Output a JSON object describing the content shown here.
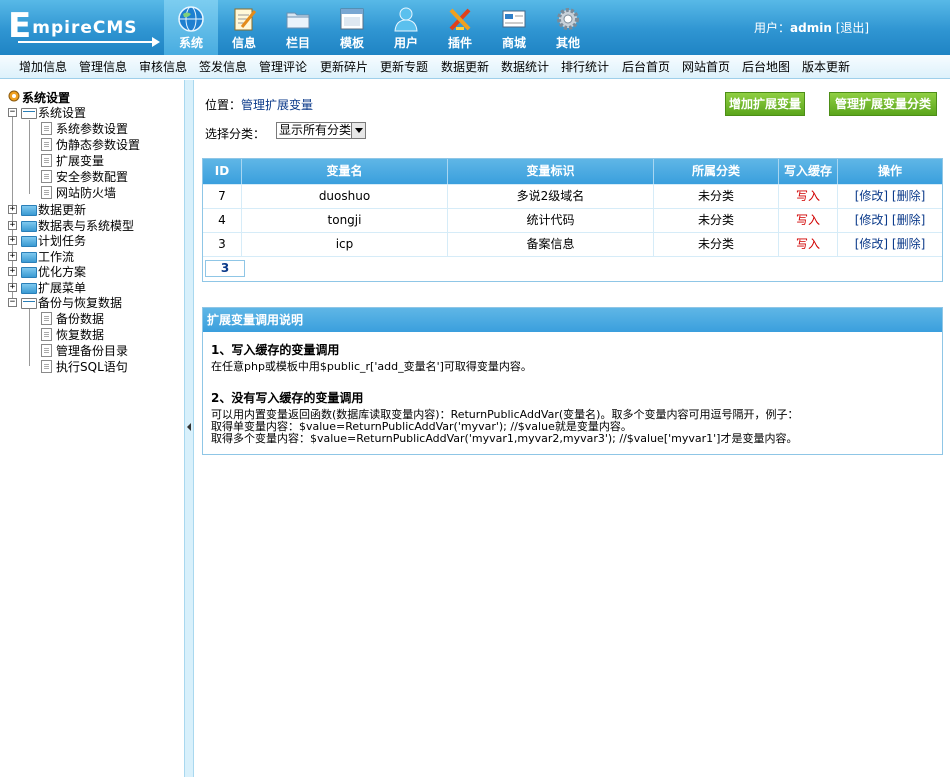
{
  "logo": {
    "big": "E",
    "rest": "mpireCMS"
  },
  "nav": [
    {
      "label": "系统",
      "icon": "globe-icon",
      "active": true
    },
    {
      "label": "信息",
      "icon": "notepad-icon"
    },
    {
      "label": "栏目",
      "icon": "folder-icon"
    },
    {
      "label": "模板",
      "icon": "window-icon"
    },
    {
      "label": "用户",
      "icon": "user-icon"
    },
    {
      "label": "插件",
      "icon": "tools-icon"
    },
    {
      "label": "商城",
      "icon": "card-icon"
    },
    {
      "label": "其他",
      "icon": "gear-icon"
    }
  ],
  "user": {
    "prefix": "用户：",
    "name": "admin",
    "logout": "[退出]"
  },
  "submenu": [
    "增加信息",
    "管理信息",
    "审核信息",
    "签发信息",
    "管理评论",
    "更新碎片",
    "更新专题",
    "数据更新",
    "数据统计",
    "排行统计",
    "后台首页",
    "网站首页",
    "后台地图",
    "版本更新"
  ],
  "sidebar": {
    "root": "系统设置",
    "groups": [
      {
        "label": "系统设置",
        "open": true,
        "children": [
          "系统参数设置",
          "伪静态参数设置",
          "扩展变量",
          "安全参数配置",
          "网站防火墙"
        ]
      },
      {
        "label": "数据更新"
      },
      {
        "label": "数据表与系统模型"
      },
      {
        "label": "计划任务"
      },
      {
        "label": "工作流"
      },
      {
        "label": "优化方案"
      },
      {
        "label": "扩展菜单"
      },
      {
        "label": "备份与恢复数据",
        "open": true,
        "children": [
          "备份数据",
          "恢复数据",
          "管理备份目录",
          "执行SQL语句"
        ]
      }
    ]
  },
  "location": {
    "prefix": "位置：",
    "link": "管理扩展变量"
  },
  "buttons": {
    "add_var": "增加扩展变量",
    "manage_class": "管理扩展变量分类"
  },
  "filter": {
    "label": "选择分类：",
    "selected": "显示所有分类"
  },
  "table": {
    "headers": [
      "ID",
      "变量名",
      "变量标识",
      "所属分类",
      "写入缓存",
      "操作"
    ],
    "rows": [
      {
        "id": "7",
        "name": "duoshuo",
        "title": "多说2级域名",
        "class": "未分类",
        "cache": "写入",
        "edit": "[修改]",
        "del": "[删除]"
      },
      {
        "id": "4",
        "name": "tongji",
        "title": "统计代码",
        "class": "未分类",
        "cache": "写入",
        "edit": "[修改]",
        "del": "[删除]"
      },
      {
        "id": "3",
        "name": "icp",
        "title": "备案信息",
        "class": "未分类",
        "cache": "写入",
        "edit": "[修改]",
        "del": "[删除]"
      }
    ],
    "page": "3"
  },
  "help": {
    "title": "扩展变量调用说明",
    "h1": "1、写入缓存的变量调用",
    "p1": "在任意php或模板中用$public_r['add_变量名']可取得变量内容。",
    "h2": "2、没有写入缓存的变量调用",
    "p2": "可以用内置变量返回函数(数据库读取变量内容)：ReturnPublicAddVar(变量名)。取多个变量内容可用逗号隔开，例子：",
    "p3": "取得单变量内容：$value=ReturnPublicAddVar('myvar'); //$value就是变量内容。",
    "p4": "取得多个变量内容：$value=ReturnPublicAddVar('myvar1,myvar2,myvar3'); //$value['myvar1']才是变量内容。"
  },
  "colors": {
    "header": "#2f95d2",
    "accent_green": "#5ba51c",
    "link": "#0b3a8a",
    "red": "#d10000"
  }
}
